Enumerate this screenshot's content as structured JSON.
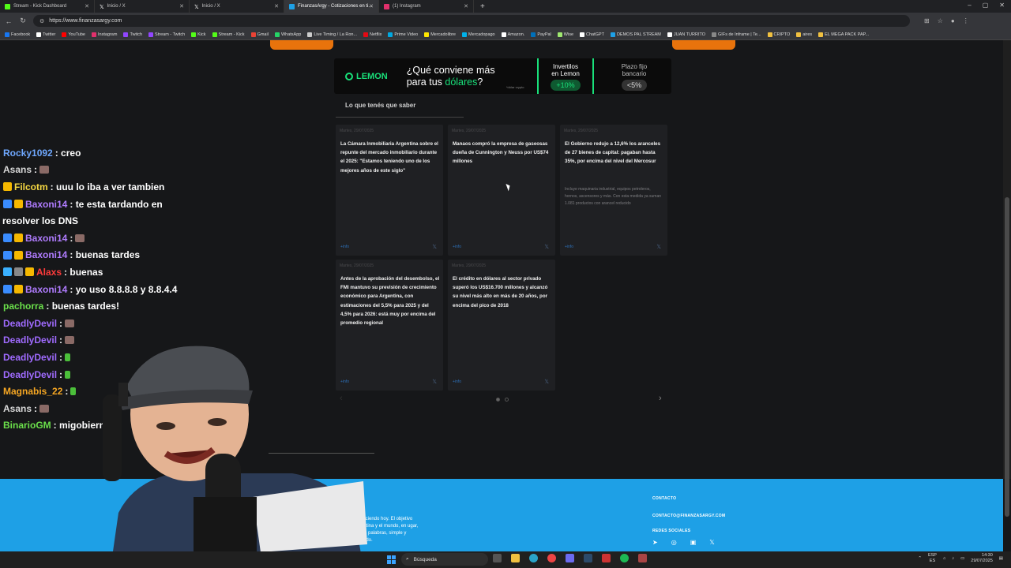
{
  "browser": {
    "tabs": [
      {
        "label": "Stream - Kick Dashboard",
        "color": "#53fc18"
      },
      {
        "label": "Inicio / X",
        "color": "#ffffff"
      },
      {
        "label": "Inicio / X",
        "color": "#ffffff"
      },
      {
        "label": "FinanzasArgy - Cotizaciones en ti...",
        "color": "#1ea0e6"
      },
      {
        "label": "(1) Instagram",
        "color": "#e1306c"
      }
    ],
    "url": "https://www.finanzasargy.com",
    "bookmarks": [
      "Facebook",
      "Twitter",
      "YouTube",
      "Instagram",
      "Twitch",
      "Stream - Twitch",
      "Kick",
      "Stream - Kick",
      "Gmail",
      "WhatsApp",
      "Live Timing / La Ron...",
      "Netflix",
      "Prime Video",
      "Mercadolibre",
      "Mercadopago",
      "Amazon.",
      "PayPal",
      "Wise",
      "ChatGPT",
      "DEMOS PAL STREAM",
      "JUAN TURRITO",
      "GIFs de Inframe | Te...",
      "CRIPTO",
      "aires",
      "EL MEGA PACK PAP..."
    ]
  },
  "banner": {
    "logo": "LEMON",
    "question_1": "¿Qué conviene más",
    "question_2": "para tus ",
    "question_highlight": "dólares",
    "question_end": "?",
    "note": "*dólar crypto",
    "invert_1": "Invertilos",
    "invert_2": "en Lemon",
    "invert_rate": "+10%",
    "plazo_1": "Plazo fijo",
    "plazo_2": "bancario",
    "plazo_rate": "<5%"
  },
  "news": {
    "section_title": "Lo que tenés que saber",
    "info_label": "+info",
    "cards": [
      {
        "date": "Martes, 29/07/2025",
        "headline": "La Cámara Inmobiliaria Argentina sobre el repunte del mercado inmobiliario durante el 2025: \"Estamos teniendo uno de los mejores años de este siglo\"",
        "desc": ""
      },
      {
        "date": "Martes, 29/07/2025",
        "headline": "Manaos compró la empresa de gaseosas dueña de Cunnington y Neuss por US$74 millones",
        "desc": ""
      },
      {
        "date": "Martes, 29/07/2025",
        "headline": "El Gobierno redujo a 12,6% los aranceles de 27 bienes de capital: pagaban hasta 35%, por encima del nivel del Mercosur",
        "desc": "Incluye maquinaria industrial, equipos petroleros, hornos, ascensores y más. Con esta medida ya suman 1.081 productos con arancel reducido"
      },
      {
        "date": "Martes, 29/07/2025",
        "headline": "Antes de la aprobación del desembolso, el FMI mantuvo su previsión de crecimiento económico para Argentina, con estimaciones del 5,5% para 2025 y del 4,5% para 2026: está muy por encima del promedio regional",
        "desc": ""
      },
      {
        "date": "Martes, 29/07/2025",
        "headline": "El crédito en dólares al sector privado superó los US$16.700 millones y alcanzó su nivel más alto en más de 20 años, por encima del pico de 2018",
        "desc": ""
      }
    ]
  },
  "footer": {
    "contact_label": "CONTACTO",
    "contact_email": "CONTACTO@FINANZASARGY.COM",
    "social_label": "REDES SOCIALES",
    "about_text": "y fuy creciendo hoy. El objetivo es Argentina y el mundo, en ugar, en pocas palabras, simple y entretenido."
  },
  "chat": [
    {
      "user": "Rocky1092",
      "color": "#6fa8ff",
      "msg": ": creo",
      "badges": [],
      "emote": ""
    },
    {
      "user": "Asans",
      "color": "#d8d8d8",
      "msg": ":",
      "badges": [],
      "emote": "brown"
    },
    {
      "user": "Filcotm",
      "color": "#f5d742",
      "msg": ": uuu lo iba a ver tambien",
      "badges": [
        "#f5b800"
      ],
      "emote": ""
    },
    {
      "user": "Baxoni14",
      "color": "#b07cff",
      "msg": ": te esta tardando en",
      "badges": [
        "#3a8cff",
        "#f5b800"
      ],
      "emote": ""
    },
    {
      "user": "",
      "color": "#ffffff",
      "msg": "resolver los DNS",
      "badges": [],
      "emote": ""
    },
    {
      "user": "Baxoni14",
      "color": "#b07cff",
      "msg": ":",
      "badges": [
        "#3a8cff",
        "#f5b800"
      ],
      "emote": "brown"
    },
    {
      "user": "Baxoni14",
      "color": "#b07cff",
      "msg": ": buenas tardes",
      "badges": [
        "#3a8cff",
        "#f5b800"
      ],
      "emote": ""
    },
    {
      "user": "Alaxs",
      "color": "#ff3b3b",
      "msg": ": buenas",
      "badges": [
        "#3ab0ff",
        "#888888",
        "#f5b800"
      ],
      "emote": ""
    },
    {
      "user": "Baxoni14",
      "color": "#b07cff",
      "msg": ": yo uso 8.8.8.8 y 8.8.4.4",
      "badges": [
        "#3a8cff",
        "#f5b800"
      ],
      "emote": ""
    },
    {
      "user": "pachorra",
      "color": "#6be04b",
      "msg": ": buenas tardes!",
      "badges": [],
      "emote": ""
    },
    {
      "user": "DeadlyDevil",
      "color": "#a06bff",
      "msg": ":",
      "badges": [],
      "emote": "brown"
    },
    {
      "user": "DeadlyDevil",
      "color": "#a06bff",
      "msg": ":",
      "badges": [],
      "emote": "brown"
    },
    {
      "user": "DeadlyDevil",
      "color": "#a06bff",
      "msg": ":",
      "badges": [],
      "emote": "green"
    },
    {
      "user": "DeadlyDevil",
      "color": "#a06bff",
      "msg": ":",
      "badges": [],
      "emote": "green"
    },
    {
      "user": "Magnabis_22",
      "color": "#f5a623",
      "msg": ":",
      "badges": [],
      "emote": "green"
    },
    {
      "user": "Asans",
      "color": "#d8d8d8",
      "msg": ":",
      "badges": [],
      "emote": "brown"
    },
    {
      "user": "BinarioGM",
      "color": "#6be04b",
      "msg": ": migobiern",
      "badges": [],
      "emote": ""
    }
  ],
  "taskbar": {
    "search": "Búsqueda",
    "lang_1": "ESP",
    "lang_2": "ES",
    "time": "14:30",
    "date": "29/07/2025"
  }
}
